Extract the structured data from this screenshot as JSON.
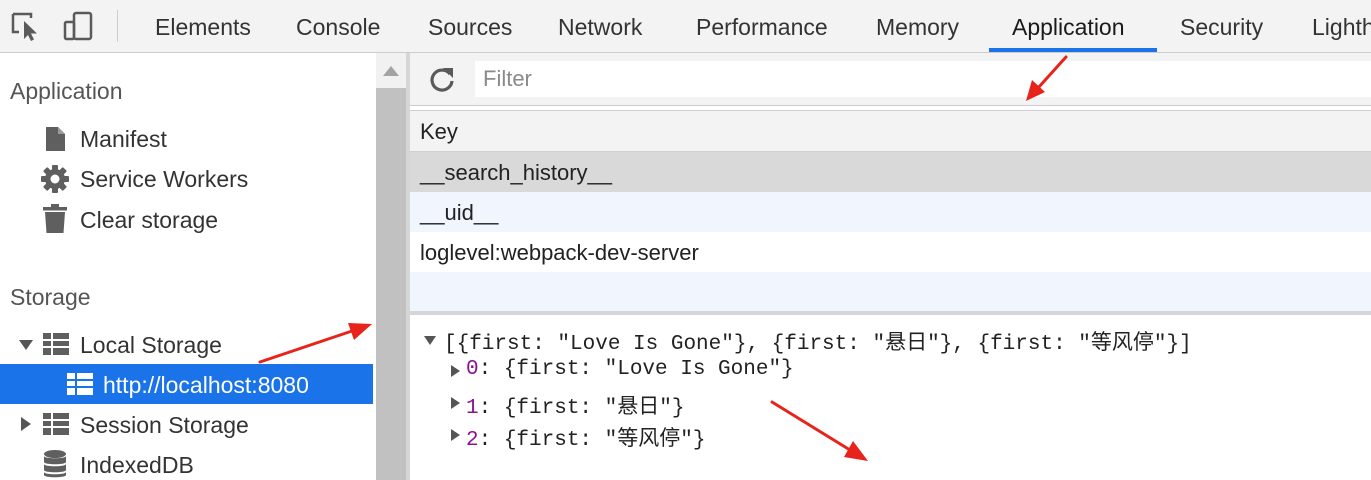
{
  "toolbar": {
    "tabs": [
      {
        "label": "Elements"
      },
      {
        "label": "Console"
      },
      {
        "label": "Sources"
      },
      {
        "label": "Network"
      },
      {
        "label": "Performance"
      },
      {
        "label": "Memory"
      },
      {
        "label": "Application",
        "active": true
      },
      {
        "label": "Security"
      },
      {
        "label": "Lighth"
      }
    ],
    "inspect_icon": "cursor-select-icon",
    "device_icon": "device-toolbar-icon"
  },
  "sidebar": {
    "application_title": "Application",
    "application_items": [
      {
        "label": "Manifest",
        "icon": "file-icon"
      },
      {
        "label": "Service Workers",
        "icon": "gear-icon"
      },
      {
        "label": "Clear storage",
        "icon": "trash-icon"
      }
    ],
    "storage_title": "Storage",
    "storage_items": [
      {
        "label": "Local Storage",
        "icon": "grid-icon",
        "expanded": true
      },
      {
        "label": "http://localhost:8080",
        "icon": "grid-icon",
        "selected": true
      },
      {
        "label": "Session Storage",
        "icon": "grid-icon",
        "expanded": false
      },
      {
        "label": "IndexedDB",
        "icon": "database-icon"
      }
    ]
  },
  "filter": {
    "placeholder": "Filter"
  },
  "table": {
    "header": "Key",
    "rows": [
      {
        "key": "__search_history__",
        "selected": true
      },
      {
        "key": "__uid__"
      },
      {
        "key": "loglevel:webpack-dev-server"
      }
    ]
  },
  "preview": {
    "summary": "[{first: \"Love Is Gone\"}, {first: \"悬日\"}, {first: \"等风停\"}]",
    "entries": [
      {
        "index": "0",
        "value": ": {first: \"Love Is Gone\"}"
      },
      {
        "index": "1",
        "value": ": {first: \"悬日\"}"
      },
      {
        "index": "2",
        "value": ": {first: \"等风停\"}"
      }
    ]
  },
  "colors": {
    "accent": "#1a73e8",
    "annotation_arrow": "#e8231c",
    "index_purple": "#881391"
  }
}
